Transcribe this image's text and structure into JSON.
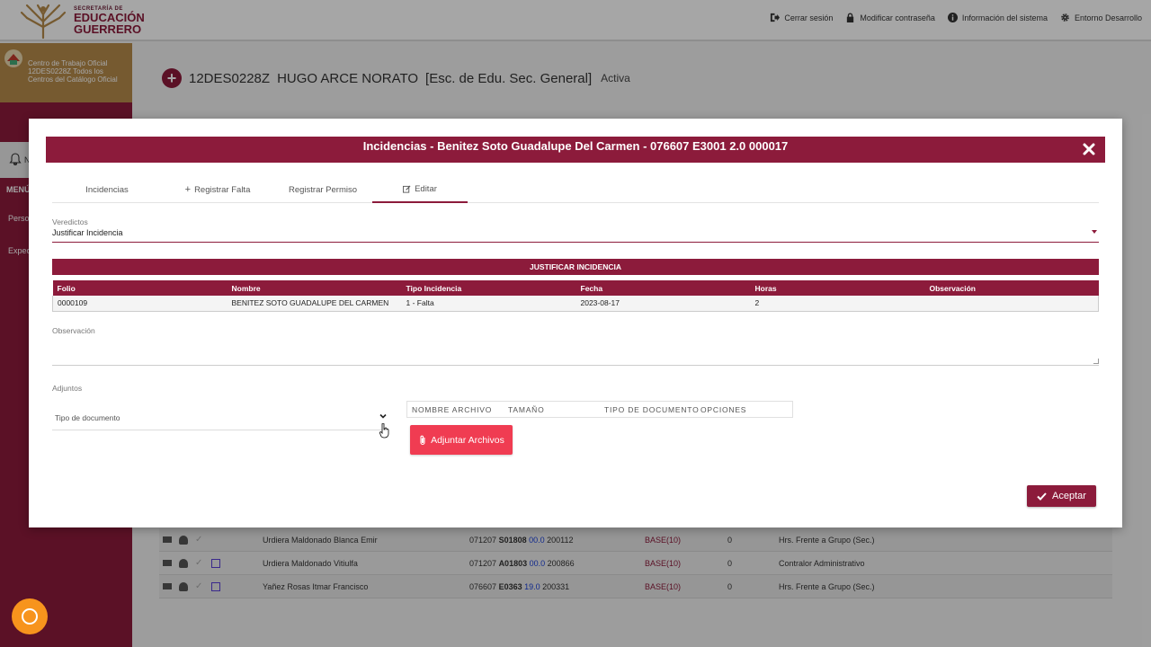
{
  "app": {
    "logo": {
      "line1": "SECRETARÍA DE",
      "line2": "EDUCACIÓN",
      "line3": "GUERRERO"
    },
    "toplinks": [
      {
        "icon": "logout-icon",
        "label": "Cerrar sesión"
      },
      {
        "icon": "lock-icon",
        "label": "Modificar contraseña"
      },
      {
        "icon": "info-icon",
        "label": "Información del sistema"
      },
      {
        "icon": "gear-icon",
        "label": "Entorno Desarrollo"
      }
    ],
    "sidebar": {
      "center_text": "Centro de Trabajo Oficial 12DES0228Z Todos los Centros del Catálogo Oficial",
      "notif_label": "N",
      "menu_label": "MENÚ",
      "items": [
        "Perso",
        "Expec"
      ]
    },
    "header": {
      "code": "12DES0228Z",
      "name": "HUGO ARCE NORATO",
      "school": "[Esc. de Edu. Sec. General]",
      "status": "Activa"
    },
    "bg_rows": [
      {
        "name": "Urdiera Maldonado Blanca Emir",
        "plaza_a": "071207",
        "plaza_b": "S01808",
        "plaza_c": "00.0",
        "plaza_d": "200112",
        "base": "BASE(10)",
        "zero": "0",
        "func": "Hrs. Frente a Grupo (Sec.)"
      },
      {
        "name": "Urdiera Maldonado Vitiulfa",
        "plaza_a": "071207",
        "plaza_b": "A01803",
        "plaza_c": "00.0",
        "plaza_d": "200866",
        "base": "BASE(10)",
        "zero": "0",
        "func": "Contralor Administrativo"
      },
      {
        "name": "Yañez Rosas Itmar Francisco",
        "plaza_a": "076607",
        "plaza_b": "E0363",
        "plaza_c": "19.0",
        "plaza_d": "200331",
        "base": "BASE(10)",
        "zero": "0",
        "func": "Hrs. Frente a Grupo (Sec.)"
      }
    ]
  },
  "modal": {
    "title": "Incidencias - Benitez Soto Guadalupe Del Carmen - 076607 E3001 2.0 000017",
    "tabs": {
      "incidencias": "Incidencias",
      "registrar_falta": "Registrar Falta",
      "registrar_permiso": "Registrar Permiso",
      "editar": "Editar"
    },
    "veredictos_label": "Veredictos",
    "veredicto_value": "Justificar Incidencia",
    "section_title": "JUSTIFICAR INCIDENCIA",
    "table": {
      "headers": [
        "Folio",
        "Nombre",
        "Tipo Incidencia",
        "Fecha",
        "Horas",
        "Observación"
      ],
      "row": [
        "0000109",
        "BENITEZ SOTO GUADALUPE DEL CARMEN",
        "1 - Falta",
        "2023-08-17",
        "2",
        ""
      ]
    },
    "observacion_label": "Observación",
    "adjuntos_label": "Adjuntos",
    "tipo_documento_placeholder": "Tipo de documento",
    "files_headers": [
      "NOMBRE ARCHIVO",
      "TAMAÑO",
      "TIPO DE DOCUMENTO",
      "OPCIONES"
    ],
    "attach_label": "Adjuntar Archivos",
    "accept_label": "Aceptar"
  },
  "colors": {
    "brand": "#8c1b3b",
    "gold": "#b58a4a",
    "attach": "#f03c52",
    "chat": "#f7941d"
  }
}
